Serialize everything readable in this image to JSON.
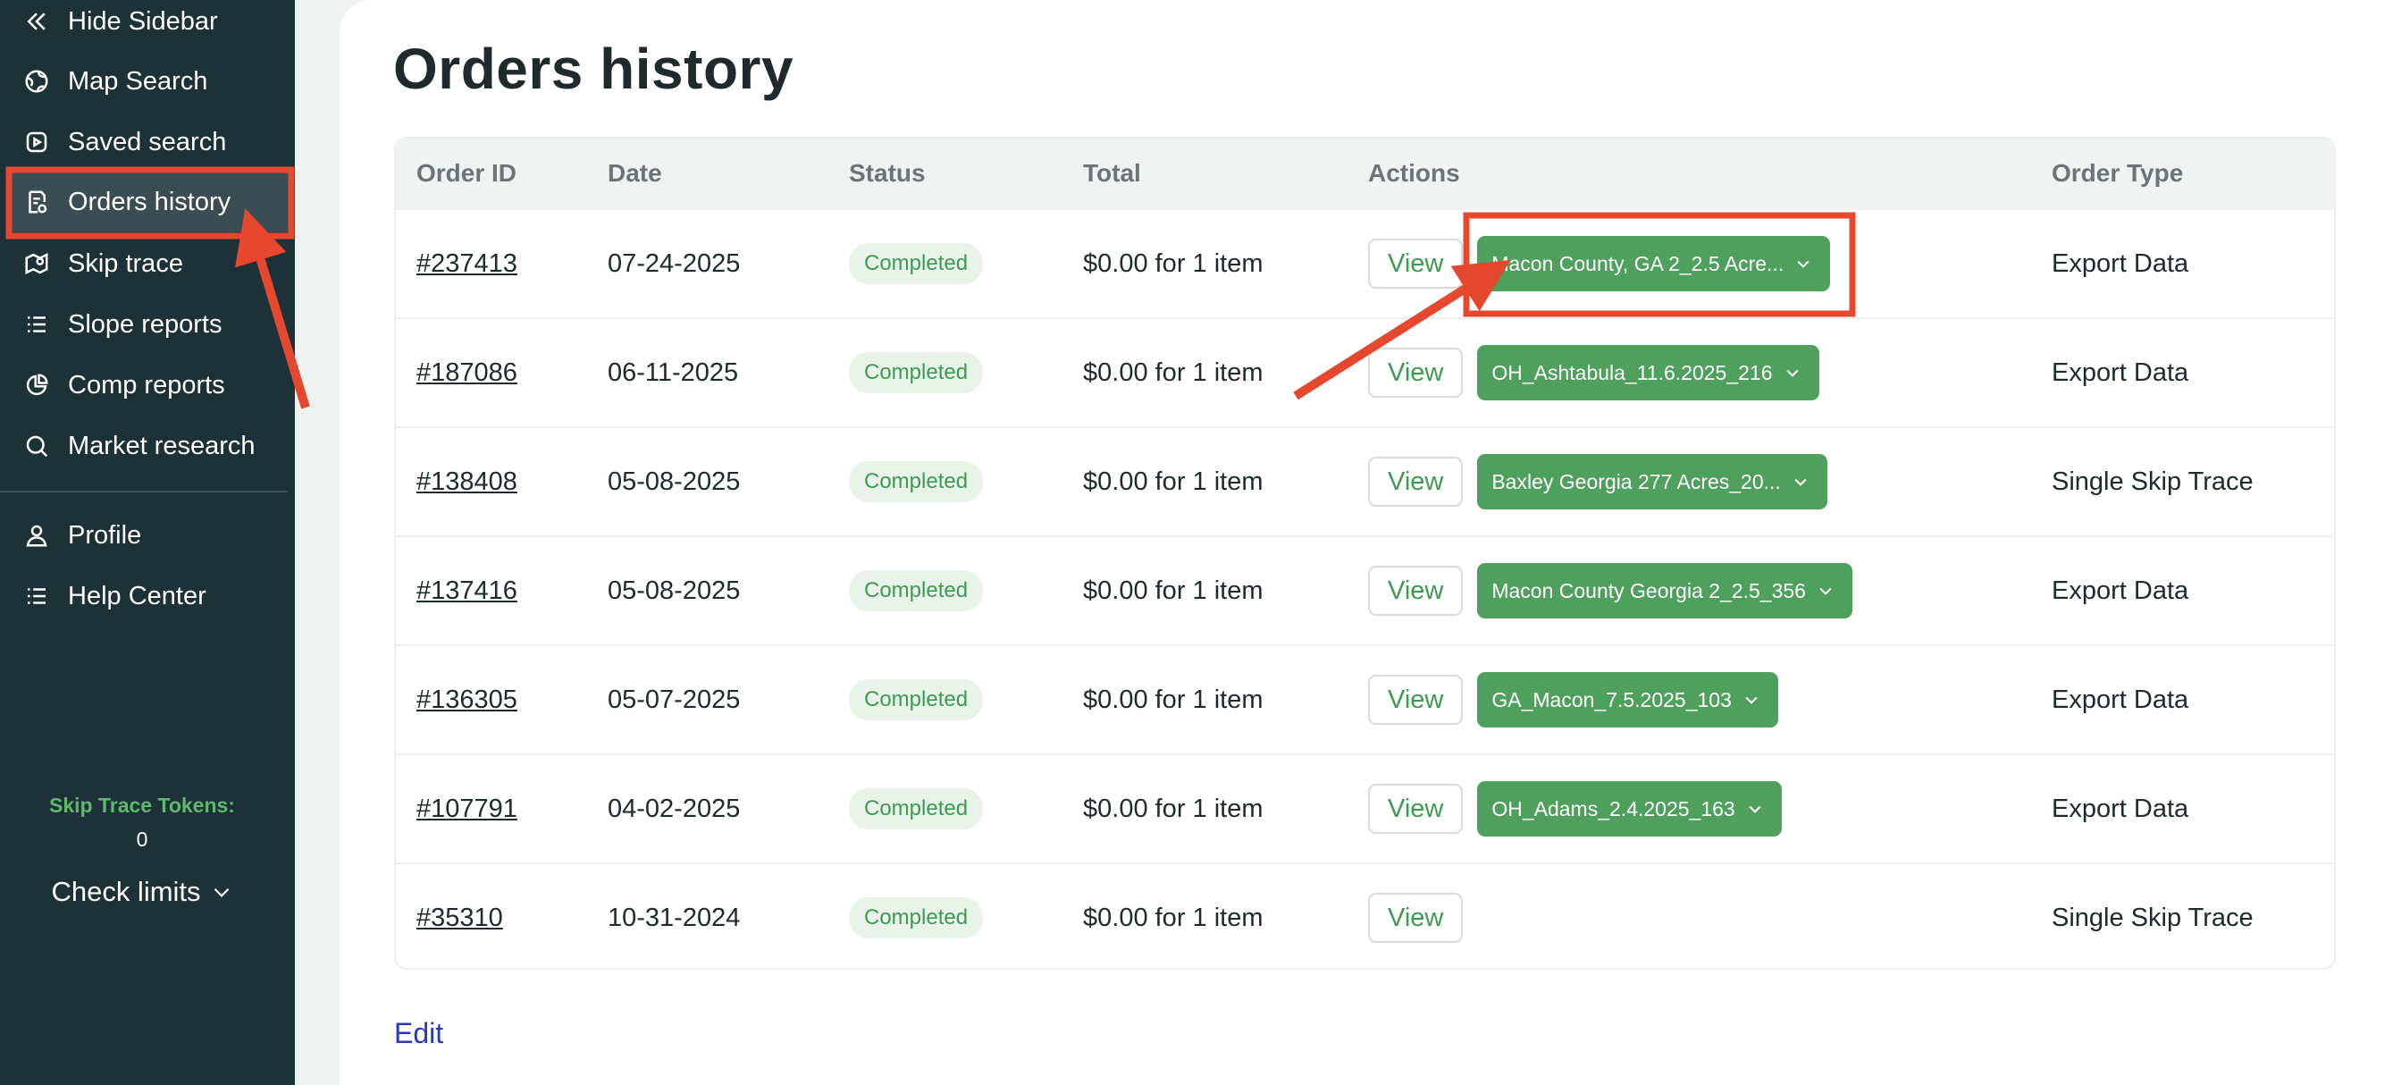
{
  "sidebar": {
    "items": [
      {
        "label": "Hide Sidebar",
        "icon": "double-chevron-left-icon"
      },
      {
        "label": "Map Search",
        "icon": "globe-icon"
      },
      {
        "label": "Saved search",
        "icon": "bookmark-icon"
      },
      {
        "label": "Orders history",
        "icon": "receipt-icon",
        "active": true
      },
      {
        "label": "Skip trace",
        "icon": "map-pin-icon"
      },
      {
        "label": "Slope reports",
        "icon": "list-icon"
      },
      {
        "label": "Comp reports",
        "icon": "pie-chart-icon"
      },
      {
        "label": "Market research",
        "icon": "search-icon"
      },
      {
        "label": "Profile",
        "icon": "user-icon"
      },
      {
        "label": "Help Center",
        "icon": "help-list-icon"
      }
    ],
    "tokens_label": "Skip Trace Tokens:",
    "tokens_value": "0",
    "check_limits": "Check limits"
  },
  "main": {
    "title": "Orders history",
    "columns": [
      "Order ID",
      "Date",
      "Status",
      "Total",
      "Actions",
      "Order Type"
    ],
    "view_label": "View",
    "rows": [
      {
        "id": "#237413",
        "date": "07-24-2025",
        "status": "Completed",
        "total": "$0.00 for 1 item",
        "file": "Macon County, GA 2_2.5 Acre...",
        "type": "Export Data"
      },
      {
        "id": "#187086",
        "date": "06-11-2025",
        "status": "Completed",
        "total": "$0.00 for 1 item",
        "file": "OH_Ashtabula_11.6.2025_216",
        "type": "Export Data"
      },
      {
        "id": "#138408",
        "date": "05-08-2025",
        "status": "Completed",
        "total": "$0.00 for 1 item",
        "file": "Baxley Georgia 277 Acres_20...",
        "type": "Single Skip Trace"
      },
      {
        "id": "#137416",
        "date": "05-08-2025",
        "status": "Completed",
        "total": "$0.00 for 1 item",
        "file": "Macon County Georgia 2_2.5_356",
        "type": "Export Data"
      },
      {
        "id": "#136305",
        "date": "05-07-2025",
        "status": "Completed",
        "total": "$0.00 for 1 item",
        "file": "GA_Macon_7.5.2025_103",
        "type": "Export Data"
      },
      {
        "id": "#107791",
        "date": "04-02-2025",
        "status": "Completed",
        "total": "$0.00 for 1 item",
        "file": "OH_Adams_2.4.2025_163",
        "type": "Export Data"
      },
      {
        "id": "#35310",
        "date": "10-31-2024",
        "status": "Completed",
        "total": "$0.00 for 1 item",
        "file": "",
        "type": "Single Skip Trace"
      }
    ],
    "edit_label": "Edit"
  },
  "colors": {
    "sidebar_bg": "#1c3138",
    "accent_green": "#4f9f5d",
    "annotation_red": "#e5472f",
    "edit_link": "#2a39b8"
  }
}
